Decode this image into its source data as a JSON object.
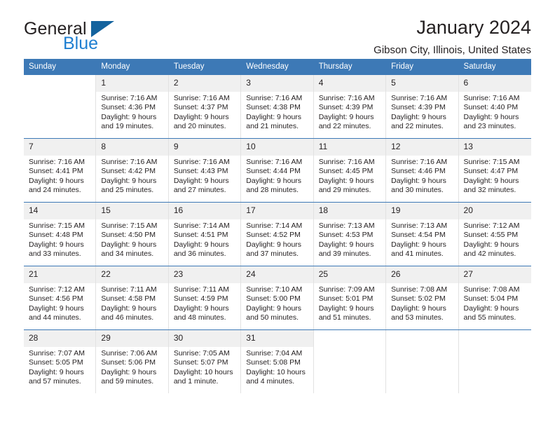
{
  "brand": {
    "name_part1": "General",
    "name_part2": "Blue",
    "triangle_color": "#14639e",
    "blue_text_color": "#1f7fd1"
  },
  "header": {
    "title": "January 2024",
    "subtitle": "Gibson City, Illinois, United States",
    "header_bar_color": "#3d79b6"
  },
  "weekdays": [
    "Sunday",
    "Monday",
    "Tuesday",
    "Wednesday",
    "Thursday",
    "Friday",
    "Saturday"
  ],
  "labels": {
    "sunrise_prefix": "Sunrise:",
    "sunset_prefix": "Sunset:",
    "daylight_prefix": "Daylight:"
  },
  "weeks": [
    [
      {
        "day": "",
        "empty": true
      },
      {
        "day": "1",
        "sunrise": "Sunrise: 7:16 AM",
        "sunset": "Sunset: 4:36 PM",
        "daylight": "Daylight: 9 hours and 19 minutes."
      },
      {
        "day": "2",
        "sunrise": "Sunrise: 7:16 AM",
        "sunset": "Sunset: 4:37 PM",
        "daylight": "Daylight: 9 hours and 20 minutes."
      },
      {
        "day": "3",
        "sunrise": "Sunrise: 7:16 AM",
        "sunset": "Sunset: 4:38 PM",
        "daylight": "Daylight: 9 hours and 21 minutes."
      },
      {
        "day": "4",
        "sunrise": "Sunrise: 7:16 AM",
        "sunset": "Sunset: 4:39 PM",
        "daylight": "Daylight: 9 hours and 22 minutes."
      },
      {
        "day": "5",
        "sunrise": "Sunrise: 7:16 AM",
        "sunset": "Sunset: 4:39 PM",
        "daylight": "Daylight: 9 hours and 22 minutes."
      },
      {
        "day": "6",
        "sunrise": "Sunrise: 7:16 AM",
        "sunset": "Sunset: 4:40 PM",
        "daylight": "Daylight: 9 hours and 23 minutes."
      }
    ],
    [
      {
        "day": "7",
        "sunrise": "Sunrise: 7:16 AM",
        "sunset": "Sunset: 4:41 PM",
        "daylight": "Daylight: 9 hours and 24 minutes."
      },
      {
        "day": "8",
        "sunrise": "Sunrise: 7:16 AM",
        "sunset": "Sunset: 4:42 PM",
        "daylight": "Daylight: 9 hours and 25 minutes."
      },
      {
        "day": "9",
        "sunrise": "Sunrise: 7:16 AM",
        "sunset": "Sunset: 4:43 PM",
        "daylight": "Daylight: 9 hours and 27 minutes."
      },
      {
        "day": "10",
        "sunrise": "Sunrise: 7:16 AM",
        "sunset": "Sunset: 4:44 PM",
        "daylight": "Daylight: 9 hours and 28 minutes."
      },
      {
        "day": "11",
        "sunrise": "Sunrise: 7:16 AM",
        "sunset": "Sunset: 4:45 PM",
        "daylight": "Daylight: 9 hours and 29 minutes."
      },
      {
        "day": "12",
        "sunrise": "Sunrise: 7:16 AM",
        "sunset": "Sunset: 4:46 PM",
        "daylight": "Daylight: 9 hours and 30 minutes."
      },
      {
        "day": "13",
        "sunrise": "Sunrise: 7:15 AM",
        "sunset": "Sunset: 4:47 PM",
        "daylight": "Daylight: 9 hours and 32 minutes."
      }
    ],
    [
      {
        "day": "14",
        "sunrise": "Sunrise: 7:15 AM",
        "sunset": "Sunset: 4:48 PM",
        "daylight": "Daylight: 9 hours and 33 minutes."
      },
      {
        "day": "15",
        "sunrise": "Sunrise: 7:15 AM",
        "sunset": "Sunset: 4:50 PM",
        "daylight": "Daylight: 9 hours and 34 minutes."
      },
      {
        "day": "16",
        "sunrise": "Sunrise: 7:14 AM",
        "sunset": "Sunset: 4:51 PM",
        "daylight": "Daylight: 9 hours and 36 minutes."
      },
      {
        "day": "17",
        "sunrise": "Sunrise: 7:14 AM",
        "sunset": "Sunset: 4:52 PM",
        "daylight": "Daylight: 9 hours and 37 minutes."
      },
      {
        "day": "18",
        "sunrise": "Sunrise: 7:13 AM",
        "sunset": "Sunset: 4:53 PM",
        "daylight": "Daylight: 9 hours and 39 minutes."
      },
      {
        "day": "19",
        "sunrise": "Sunrise: 7:13 AM",
        "sunset": "Sunset: 4:54 PM",
        "daylight": "Daylight: 9 hours and 41 minutes."
      },
      {
        "day": "20",
        "sunrise": "Sunrise: 7:12 AM",
        "sunset": "Sunset: 4:55 PM",
        "daylight": "Daylight: 9 hours and 42 minutes."
      }
    ],
    [
      {
        "day": "21",
        "sunrise": "Sunrise: 7:12 AM",
        "sunset": "Sunset: 4:56 PM",
        "daylight": "Daylight: 9 hours and 44 minutes."
      },
      {
        "day": "22",
        "sunrise": "Sunrise: 7:11 AM",
        "sunset": "Sunset: 4:58 PM",
        "daylight": "Daylight: 9 hours and 46 minutes."
      },
      {
        "day": "23",
        "sunrise": "Sunrise: 7:11 AM",
        "sunset": "Sunset: 4:59 PM",
        "daylight": "Daylight: 9 hours and 48 minutes."
      },
      {
        "day": "24",
        "sunrise": "Sunrise: 7:10 AM",
        "sunset": "Sunset: 5:00 PM",
        "daylight": "Daylight: 9 hours and 50 minutes."
      },
      {
        "day": "25",
        "sunrise": "Sunrise: 7:09 AM",
        "sunset": "Sunset: 5:01 PM",
        "daylight": "Daylight: 9 hours and 51 minutes."
      },
      {
        "day": "26",
        "sunrise": "Sunrise: 7:08 AM",
        "sunset": "Sunset: 5:02 PM",
        "daylight": "Daylight: 9 hours and 53 minutes."
      },
      {
        "day": "27",
        "sunrise": "Sunrise: 7:08 AM",
        "sunset": "Sunset: 5:04 PM",
        "daylight": "Daylight: 9 hours and 55 minutes."
      }
    ],
    [
      {
        "day": "28",
        "sunrise": "Sunrise: 7:07 AM",
        "sunset": "Sunset: 5:05 PM",
        "daylight": "Daylight: 9 hours and 57 minutes."
      },
      {
        "day": "29",
        "sunrise": "Sunrise: 7:06 AM",
        "sunset": "Sunset: 5:06 PM",
        "daylight": "Daylight: 9 hours and 59 minutes."
      },
      {
        "day": "30",
        "sunrise": "Sunrise: 7:05 AM",
        "sunset": "Sunset: 5:07 PM",
        "daylight": "Daylight: 10 hours and 1 minute."
      },
      {
        "day": "31",
        "sunrise": "Sunrise: 7:04 AM",
        "sunset": "Sunset: 5:08 PM",
        "daylight": "Daylight: 10 hours and 4 minutes."
      },
      {
        "day": "",
        "empty": true
      },
      {
        "day": "",
        "empty": true
      },
      {
        "day": "",
        "empty": true
      }
    ]
  ]
}
